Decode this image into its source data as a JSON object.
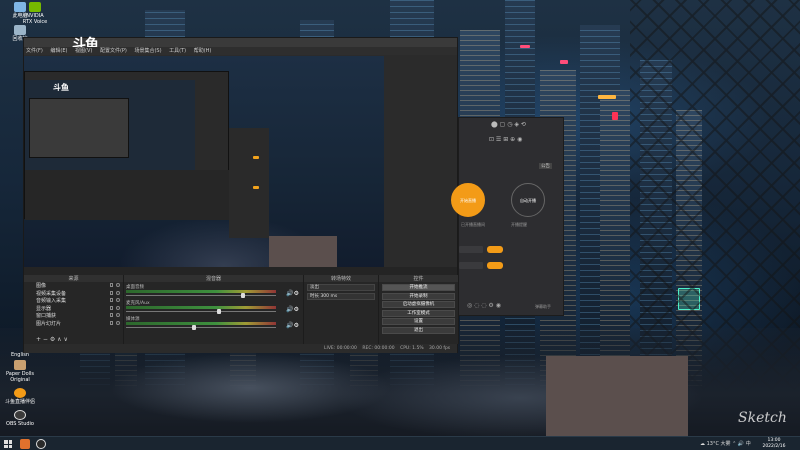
{
  "colors": {
    "accent_orange": "#f39b17",
    "obs_bg": "#2b2b2b",
    "placeholder_brown": "#5b4f4d"
  },
  "desktop_icons": [
    {
      "label": "此电脑",
      "icon": "computer-icon"
    },
    {
      "label": "NVIDIA RTX Voice",
      "icon": "nvidia-icon"
    },
    {
      "label": "回收站",
      "icon": "recycle-bin-icon"
    }
  ],
  "desktop_icons_lower": [
    {
      "label": "English",
      "icon": "folder-icon"
    },
    {
      "label": "Paper Dolls Original",
      "icon": "game-icon"
    },
    {
      "label": "斗鱼直播伴侣",
      "icon": "douyu-icon"
    },
    {
      "label": "OBS Studio",
      "icon": "obs-icon"
    }
  ],
  "obs": {
    "logo_text": "斗鱼",
    "menu": [
      "文件(F)",
      "编辑(E)",
      "视图(V)",
      "配置文件(P)",
      "场景集合(S)",
      "工具(T)",
      "帮助(H)"
    ],
    "docks": {
      "sources_title": "来源",
      "mixer_title": "混音器",
      "transitions_title": "转场特效",
      "controls_title": "控件"
    },
    "sources": [
      "图像",
      "视频采集设备",
      "音频输入采集",
      "显示器",
      "窗口捕获",
      "图片幻灯片"
    ],
    "mixer_tracks": [
      {
        "name": "桌面音频",
        "level": 0.78
      },
      {
        "name": "麦克风/Aux",
        "level": 0.62
      },
      {
        "name": "媒体源",
        "level": 0.45
      }
    ],
    "transitions": {
      "type": "淡出",
      "duration_label": "时长",
      "duration_value": "300 ms"
    },
    "controls": [
      "开始推流",
      "开始录制",
      "启动虚拟摄像机",
      "工作室模式",
      "设置",
      "退出"
    ],
    "status": [
      "LIVE: 00:00:00",
      "REC: 00:00:00",
      "CPU: 1.5%",
      "30.00 fps"
    ]
  },
  "douyu_panel": {
    "btn_start": "开始直播",
    "btn_auto": "自动开播",
    "caption_left": "已开播直播间",
    "caption_right": "开播提醒",
    "badge": "公告",
    "bottom_hint": "弹幕助手"
  },
  "taskbar": {
    "weather": "13°C 大雾",
    "time": "13:00",
    "date": "2022/2/16"
  },
  "signature": "Sketch"
}
